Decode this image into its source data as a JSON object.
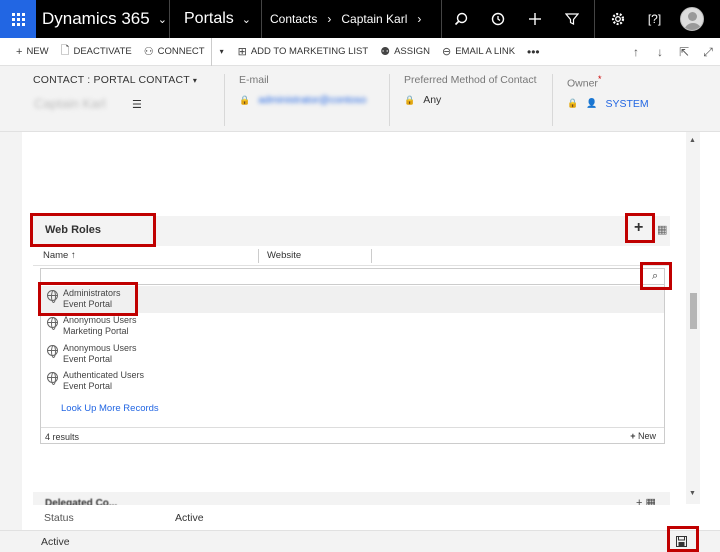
{
  "nav": {
    "app_name": "Dynamics 365",
    "area_name": "Portals",
    "breadcrumb": [
      "Contacts",
      "Captain Karl"
    ]
  },
  "commands": {
    "new": "NEW",
    "deactivate": "DEACTIVATE",
    "connect": "CONNECT",
    "add_marketing": "ADD TO MARKETING LIST",
    "assign": "ASSIGN",
    "email_link": "EMAIL A LINK"
  },
  "header": {
    "entity_type": "CONTACT : PORTAL CONTACT",
    "record_name": "Captain Karl",
    "email_label": "E-mail",
    "email_value": "administrator@contoso",
    "contact_method_label": "Preferred Method of Contact",
    "contact_method_value": "Any",
    "owner_label": "Owner",
    "owner_value": "SYSTEM"
  },
  "web_roles": {
    "title": "Web Roles",
    "col_name": "Name",
    "col_website": "Website",
    "items": [
      {
        "name": "Administrators",
        "portal": "Event Portal"
      },
      {
        "name": "Anonymous Users",
        "portal": "Marketing Portal"
      },
      {
        "name": "Anonymous Users",
        "portal": "Event Portal"
      },
      {
        "name": "Authenticated Users",
        "portal": "Event Portal"
      }
    ],
    "look_up_more": "Look Up More Records",
    "result_count": "4 results",
    "new_label": "New"
  },
  "next_section_title": "Delegated Co...",
  "status": {
    "label": "Status",
    "value": "Active",
    "bottom_status": "Active"
  },
  "colors": {
    "nav_bg": "#000000",
    "waffle_bg": "#2266e3",
    "link": "#2266e3",
    "highlight": "#c00000"
  }
}
